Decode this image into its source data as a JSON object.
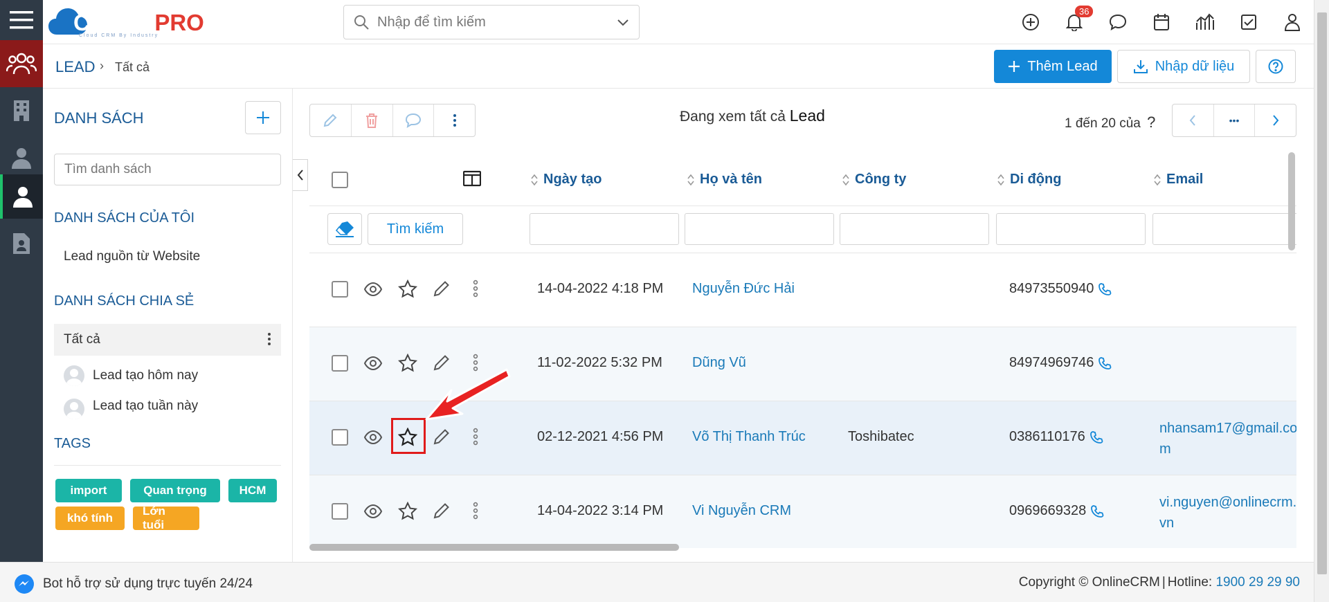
{
  "header": {
    "logo_main": "CLOUD",
    "logo_accent": "PRO",
    "logo_sub": "Cloud CRM By Industry",
    "search_placeholder": "Nhập để tìm kiếm",
    "notification_count": "36"
  },
  "breadcrumb": {
    "root": "LEAD",
    "separator": "›",
    "current": "Tất cả"
  },
  "actions": {
    "add_lead": "Thêm Lead",
    "import": "Nhập dữ liệu"
  },
  "sidebar": {
    "title": "DANH SÁCH",
    "search_placeholder": "Tìm danh sách",
    "my_lists_title": "DANH SÁCH CỦA TÔI",
    "my_lists": [
      "Lead nguồn từ Website"
    ],
    "shared_title": "DANH SÁCH CHIA SẺ",
    "shared_lists": [
      "Tất cả",
      "Lead tạo hôm nay",
      "Lead tạo tuần này"
    ],
    "tags_title": "TAGS",
    "tags": [
      {
        "label": "import",
        "color": "#1bb5a7"
      },
      {
        "label": "Quan trọng",
        "color": "#1bb5a7"
      },
      {
        "label": "HCM",
        "color": "#1bb5a7"
      },
      {
        "label": "khó tính",
        "color": "#f5a623"
      },
      {
        "label": "Lớn tuổi",
        "color": "#f5a623"
      }
    ]
  },
  "main": {
    "view_prefix": "Đang xem tất cả",
    "view_entity": "Lead",
    "pager_text": "1 đến 20 của",
    "pager_unknown": "?",
    "pager_more": "•••",
    "columns": [
      "Ngày tạo",
      "Họ và tên",
      "Công ty",
      "Di động",
      "Email"
    ],
    "search_button": "Tìm kiếm",
    "rows": [
      {
        "date": "14-04-2022 4:18 PM",
        "name": "Nguyễn Đức Hải",
        "company": "",
        "mobile": "84973550940",
        "email": ""
      },
      {
        "date": "11-02-2022 5:32 PM",
        "name": "Dũng Vũ",
        "company": "",
        "mobile": "84974969746",
        "email": ""
      },
      {
        "date": "02-12-2021 4:56 PM",
        "name": "Võ Thị Thanh Trúc",
        "company": "Toshibatec",
        "mobile": "0386110176",
        "email": "nhansam17@gmail.com"
      },
      {
        "date": "14-04-2022 3:14 PM",
        "name": "Vi Nguyễn CRM",
        "company": "",
        "mobile": "0969669328",
        "email": "vi.nguyen@onlinecrm.vn"
      }
    ]
  },
  "footer": {
    "bot_text": "Bot hỗ trợ sử dụng trực tuyến 24/24",
    "copyright": "Copyright © OnlineCRM",
    "separator": "|",
    "hotline_label": "Hotline:",
    "hotline": "1900 29 29 90"
  },
  "colors": {
    "brand": "#1488d8",
    "title": "#1a5b96",
    "highlight": "#e01b1b",
    "rail": "#2f3a46"
  }
}
